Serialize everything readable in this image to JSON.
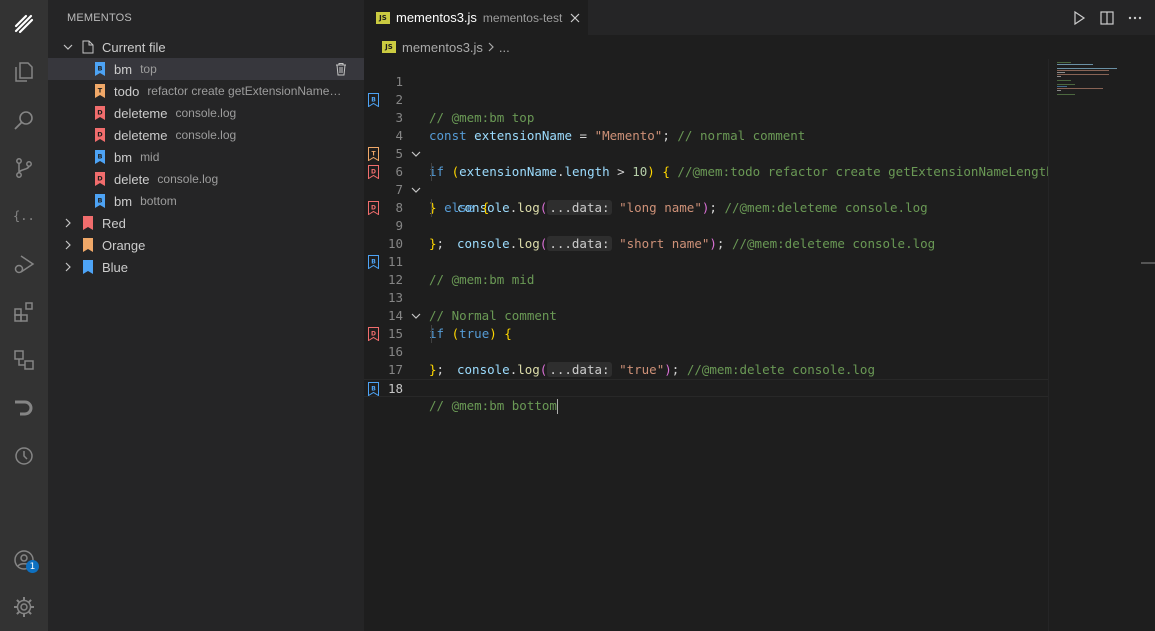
{
  "colors": {
    "red": "#f16d6d",
    "orange": "#f0a868",
    "blue": "#4da3f5",
    "accent": "#0e70c0"
  },
  "activity_bar": {
    "icons": [
      "mementos-icon",
      "explorer-icon",
      "search-icon",
      "source-control-icon",
      "json-braces-icon",
      "run-debug-icon",
      "extensions-icon",
      "remote-explorer-icon",
      "live-share-icon",
      "timeline-icon",
      "account-icon",
      "settings-gear-icon"
    ],
    "account_badge": "1"
  },
  "sidebar": {
    "title": "MEMENTOS",
    "current_file_label": "Current file",
    "items": [
      {
        "type": "bm",
        "letter": "B",
        "label": "bm",
        "desc": "top",
        "color": "blue"
      },
      {
        "type": "todo",
        "letter": "T",
        "label": "todo",
        "desc": "refactor create getExtensionNameLe...",
        "color": "orange"
      },
      {
        "type": "deleteme",
        "letter": "D",
        "label": "deleteme",
        "desc": "console.log",
        "color": "red"
      },
      {
        "type": "deleteme",
        "letter": "D",
        "label": "deleteme",
        "desc": "console.log",
        "color": "red"
      },
      {
        "type": "bm",
        "letter": "B",
        "label": "bm",
        "desc": "mid",
        "color": "blue"
      },
      {
        "type": "delete",
        "letter": "D",
        "label": "delete",
        "desc": "console.log",
        "color": "red"
      },
      {
        "type": "bm",
        "letter": "B",
        "label": "bm",
        "desc": "bottom",
        "color": "blue"
      }
    ],
    "groups": [
      {
        "label": "Red",
        "color": "red"
      },
      {
        "label": "Orange",
        "color": "orange"
      },
      {
        "label": "Blue",
        "color": "blue"
      }
    ]
  },
  "tab": {
    "icon": "JS",
    "name": "mementos3.js",
    "desc": "mementos-test"
  },
  "breadcrumb": {
    "file": "mementos3.js",
    "trail": "..."
  },
  "editor": {
    "lines": [
      {
        "n": "1"
      },
      {
        "n": "2",
        "gutter": "B"
      },
      {
        "n": "3"
      },
      {
        "n": "4"
      },
      {
        "n": "5",
        "gutter": "T"
      },
      {
        "n": "6",
        "gutter": "D"
      },
      {
        "n": "7"
      },
      {
        "n": "8",
        "gutter": "D"
      },
      {
        "n": "9"
      },
      {
        "n": "10"
      },
      {
        "n": "11",
        "gutter": "B"
      },
      {
        "n": "12"
      },
      {
        "n": "13"
      },
      {
        "n": "14"
      },
      {
        "n": "15",
        "gutter": "D"
      },
      {
        "n": "16"
      },
      {
        "n": "17"
      },
      {
        "n": "18",
        "gutter": "B"
      }
    ],
    "code": {
      "l2": "// @mem:bm top",
      "l3_kw": "const",
      "l3_var": "extensionName",
      "l3_eq": " = ",
      "l3_str": "\"Memento\"",
      "l3_semi": "; ",
      "l3_comment": "// normal comment",
      "l5_kw": "if",
      "l5_var1": "extensionName",
      "l5_dot": ".",
      "l5_var2": "length",
      "l5_op": " > ",
      "l5_num": "10",
      "l5_comment": "//@mem:todo refactor create getExtensionNameLength",
      "l6_obj": "console",
      "l6_fn": "log",
      "l6_hint": "...data:",
      "l6_str": "\"long name\"",
      "l6_comment": "//@mem:deleteme console.log",
      "l7_kw": "else",
      "l8_obj": "console",
      "l8_fn": "log",
      "l8_hint": "...data:",
      "l8_str": "\"short name\"",
      "l8_comment": "//@mem:deleteme console.log",
      "l11": "// @mem:bm mid",
      "l13": "// Normal comment",
      "l14_kw": "if",
      "l14_val": "true",
      "l15_obj": "console",
      "l15_fn": "log",
      "l15_hint": "...data:",
      "l15_str": "\"true\"",
      "l15_comment": "//@mem:delete console.log",
      "l18": "// @mem:bm bottom"
    }
  }
}
